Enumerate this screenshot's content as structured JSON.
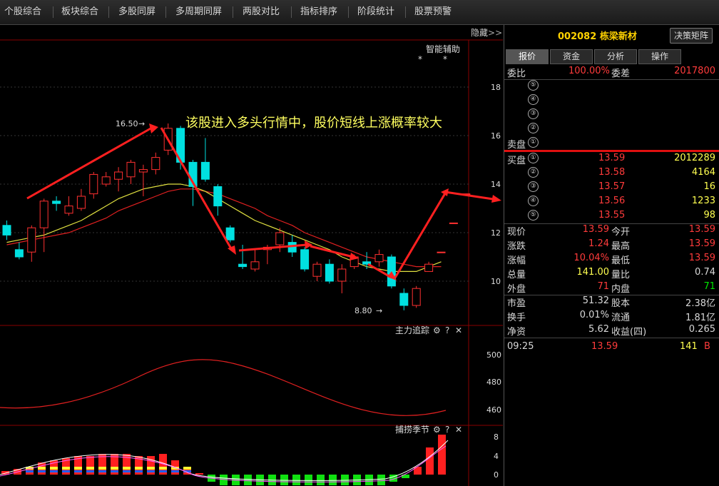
{
  "topbar": {
    "tabs": [
      "个股综合",
      "板块综合",
      "多股同屏",
      "多周期同屏",
      "两股对比",
      "指标排序",
      "阶段统计",
      "股票预警"
    ]
  },
  "chart": {
    "hide_label": "隐藏",
    "assist_label": "智能辅助",
    "annotation": "该股进入多头行情中，股价短线上涨概率较大",
    "high_label": "16.50",
    "low_label": "8.80",
    "price_axis": [
      "18",
      "16",
      "14",
      "12",
      "10"
    ],
    "panel2_title": "主力追踪",
    "panel2_axis": [
      "500",
      "480",
      "460"
    ],
    "panel3_title": "捕捞季节",
    "panel3_axis": [
      "8",
      "4",
      "0"
    ]
  },
  "chart_data": {
    "type": "candlestick",
    "yaxis_ticks": [
      10,
      12,
      14,
      16,
      18
    ],
    "high_marker": 16.5,
    "low_marker": 8.8,
    "candles": [
      {
        "o": 12.3,
        "c": 11.9,
        "h": 12.5,
        "l": 11.7
      },
      {
        "o": 11.3,
        "c": 11.0,
        "h": 11.6,
        "l": 10.9
      },
      {
        "o": 11.2,
        "c": 12.2,
        "h": 12.3,
        "l": 10.8
      },
      {
        "o": 12.2,
        "c": 13.3,
        "h": 13.4,
        "l": 11.2
      },
      {
        "o": 13.3,
        "c": 13.2,
        "h": 13.5,
        "l": 12.9
      },
      {
        "o": 12.8,
        "c": 13.1,
        "h": 13.5,
        "l": 12.7
      },
      {
        "o": 13.0,
        "c": 13.5,
        "h": 13.8,
        "l": 12.9
      },
      {
        "o": 13.6,
        "c": 14.4,
        "h": 14.5,
        "l": 13.4
      },
      {
        "o": 14.0,
        "c": 14.3,
        "h": 14.5,
        "l": 13.9
      },
      {
        "o": 14.2,
        "c": 14.5,
        "h": 14.7,
        "l": 13.7
      },
      {
        "o": 14.3,
        "c": 14.9,
        "h": 15.0,
        "l": 14.0
      },
      {
        "o": 14.5,
        "c": 14.6,
        "h": 14.8,
        "l": 13.5
      },
      {
        "o": 14.6,
        "c": 15.1,
        "h": 15.3,
        "l": 14.4
      },
      {
        "o": 15.4,
        "c": 16.3,
        "h": 16.5,
        "l": 15.2
      },
      {
        "o": 16.3,
        "c": 14.9,
        "h": 16.4,
        "l": 14.6
      },
      {
        "o": 14.9,
        "c": 13.9,
        "h": 15.0,
        "l": 13.1
      },
      {
        "o": 14.9,
        "c": 14.2,
        "h": 15.9,
        "l": 14.1
      },
      {
        "o": 13.9,
        "c": 13.1,
        "h": 14.0,
        "l": 12.7
      },
      {
        "o": 12.2,
        "c": 11.7,
        "h": 12.3,
        "l": 11.6
      },
      {
        "o": 10.7,
        "c": 10.6,
        "h": 11.5,
        "l": 10.5
      },
      {
        "o": 10.5,
        "c": 10.8,
        "h": 11.3,
        "l": 10.4
      },
      {
        "o": 11.3,
        "c": 11.4,
        "h": 11.5,
        "l": 10.7
      },
      {
        "o": 11.5,
        "c": 12.0,
        "h": 12.2,
        "l": 11.2
      },
      {
        "o": 11.6,
        "c": 11.2,
        "h": 11.9,
        "l": 11.0
      },
      {
        "o": 11.3,
        "c": 10.5,
        "h": 11.4,
        "l": 10.4
      },
      {
        "o": 10.2,
        "c": 10.7,
        "h": 10.8,
        "l": 10.0
      },
      {
        "o": 10.7,
        "c": 10.0,
        "h": 10.9,
        "l": 9.9
      },
      {
        "o": 10.0,
        "c": 10.5,
        "h": 10.7,
        "l": 9.5
      },
      {
        "o": 10.6,
        "c": 11.0,
        "h": 11.1,
        "l": 10.5
      },
      {
        "o": 10.8,
        "c": 10.7,
        "h": 11.2,
        "l": 10.5
      },
      {
        "o": 10.8,
        "c": 11.1,
        "h": 11.3,
        "l": 10.6
      },
      {
        "o": 11.0,
        "c": 9.8,
        "h": 11.1,
        "l": 9.7
      },
      {
        "o": 9.5,
        "c": 9.0,
        "h": 9.7,
        "l": 8.8
      },
      {
        "o": 9.0,
        "c": 9.7,
        "h": 9.8,
        "l": 8.9
      },
      {
        "o": 10.4,
        "c": 10.7,
        "h": 10.8,
        "l": 10.4
      },
      {
        "o": 11.2,
        "c": 11.2,
        "h": 11.2,
        "l": 11.2
      },
      {
        "o": 12.4,
        "c": 12.4,
        "h": 12.4,
        "l": 12.4
      },
      {
        "o": 13.6,
        "c": 13.6,
        "h": 13.6,
        "l": 13.6
      }
    ],
    "ma_short": [
      11.6,
      11.7,
      11.8,
      11.9,
      12.1,
      12.3,
      12.5,
      12.8,
      13.1,
      13.4,
      13.6,
      13.8,
      13.9,
      14.0,
      14.0,
      13.9,
      13.7,
      13.4,
      13.1,
      12.8,
      12.5,
      12.3,
      12.1,
      11.9,
      11.7,
      11.5,
      11.3,
      11.0,
      10.8,
      10.6,
      10.5,
      10.4,
      10.4,
      10.4,
      10.6,
      10.8
    ],
    "ma_long": [
      11.5,
      11.6,
      11.7,
      11.8,
      11.9,
      12.0,
      12.2,
      12.4,
      12.6,
      12.9,
      13.1,
      13.3,
      13.5,
      13.7,
      13.8,
      13.8,
      13.7,
      13.6,
      13.4,
      13.2,
      13.0,
      12.7,
      12.5,
      12.3,
      12.0,
      11.8,
      11.6,
      11.4,
      11.2,
      11.0,
      10.9,
      10.8,
      10.7,
      10.6,
      10.6,
      10.6
    ],
    "panel2": {
      "axis": [
        460,
        480,
        500
      ]
    },
    "panel3": {
      "axis": [
        0,
        4,
        8
      ]
    }
  },
  "quote": {
    "code": "002082",
    "name": "栋梁新材",
    "matrix_button": "决策矩阵",
    "tabs": [
      "报价",
      "资金",
      "分析",
      "操作"
    ],
    "weibi_label": "委比",
    "weibi": "100.00%",
    "weicha_label": "委差",
    "weicha": "2017800",
    "sell_label": "卖盘",
    "buy_label": "买盘",
    "levels": [
      "⑤",
      "④",
      "③",
      "②",
      "①"
    ],
    "buy_levels": [
      "①",
      "②",
      "③",
      "④",
      "⑤"
    ],
    "bids": [
      {
        "price": "13.59",
        "vol": "2012289"
      },
      {
        "price": "13.58",
        "vol": "4164"
      },
      {
        "price": "13.57",
        "vol": "16"
      },
      {
        "price": "13.56",
        "vol": "1233"
      },
      {
        "price": "13.55",
        "vol": "98"
      }
    ],
    "stats": [
      {
        "l1": "现价",
        "v1": "13.59",
        "l2": "今开",
        "v2": "13.59"
      },
      {
        "l1": "涨跌",
        "v1": "1.24",
        "l2": "最高",
        "v2": "13.59"
      },
      {
        "l1": "涨幅",
        "v1": "10.04%",
        "l2": "最低",
        "v2": "13.59"
      },
      {
        "l1": "总量",
        "v1": "141.00",
        "l2": "量比",
        "v2": "0.74"
      },
      {
        "l1": "外盘",
        "v1": "71",
        "l2": "内盘",
        "v2": "71"
      }
    ],
    "fund": [
      {
        "l1": "市盈",
        "v1": "51.32",
        "l2": "股本",
        "v2": "2.38亿"
      },
      {
        "l1": "换手",
        "v1": "0.01%",
        "l2": "流通",
        "v2": "1.81亿"
      },
      {
        "l1": "净资",
        "v1": "5.62",
        "l2": "收益(四)",
        "v2": "0.265"
      }
    ],
    "tick": {
      "time": "09:25",
      "price": "13.59",
      "vol": "141",
      "side": "B"
    }
  }
}
